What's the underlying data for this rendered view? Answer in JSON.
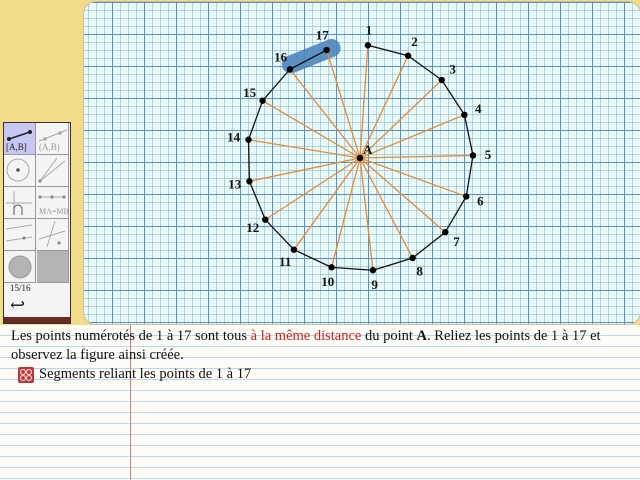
{
  "figure": {
    "center_label": "A",
    "points": [
      {
        "label": "1"
      },
      {
        "label": "2"
      },
      {
        "label": "3"
      },
      {
        "label": "4"
      },
      {
        "label": "5"
      },
      {
        "label": "6"
      },
      {
        "label": "7"
      },
      {
        "label": "8"
      },
      {
        "label": "9"
      },
      {
        "label": "10"
      },
      {
        "label": "11"
      },
      {
        "label": "12"
      },
      {
        "label": "13"
      },
      {
        "label": "14"
      },
      {
        "label": "15"
      },
      {
        "label": "16"
      },
      {
        "label": "17"
      }
    ],
    "colors": {
      "radius": "#e08c3a",
      "polygon": "#111111",
      "selection": "#4f86bd",
      "point": "#000000"
    }
  },
  "toolbox": {
    "segment_label": "[A,B]",
    "line_label": "(A,B)",
    "midpoint_label": "MA=MB",
    "page_counter": "15/16"
  },
  "notebook": {
    "instruction_part1": "Les points numérotés de 1 à 17 sont tous ",
    "instruction_highlight": "à la même distance",
    "instruction_part2": " du point ",
    "instruction_point": "A",
    "instruction_part3": ". Reliez les points de 1 à 17 et observez la figure ainsi créée.",
    "segment_item": "Segments reliant les points de 1 à 17"
  }
}
